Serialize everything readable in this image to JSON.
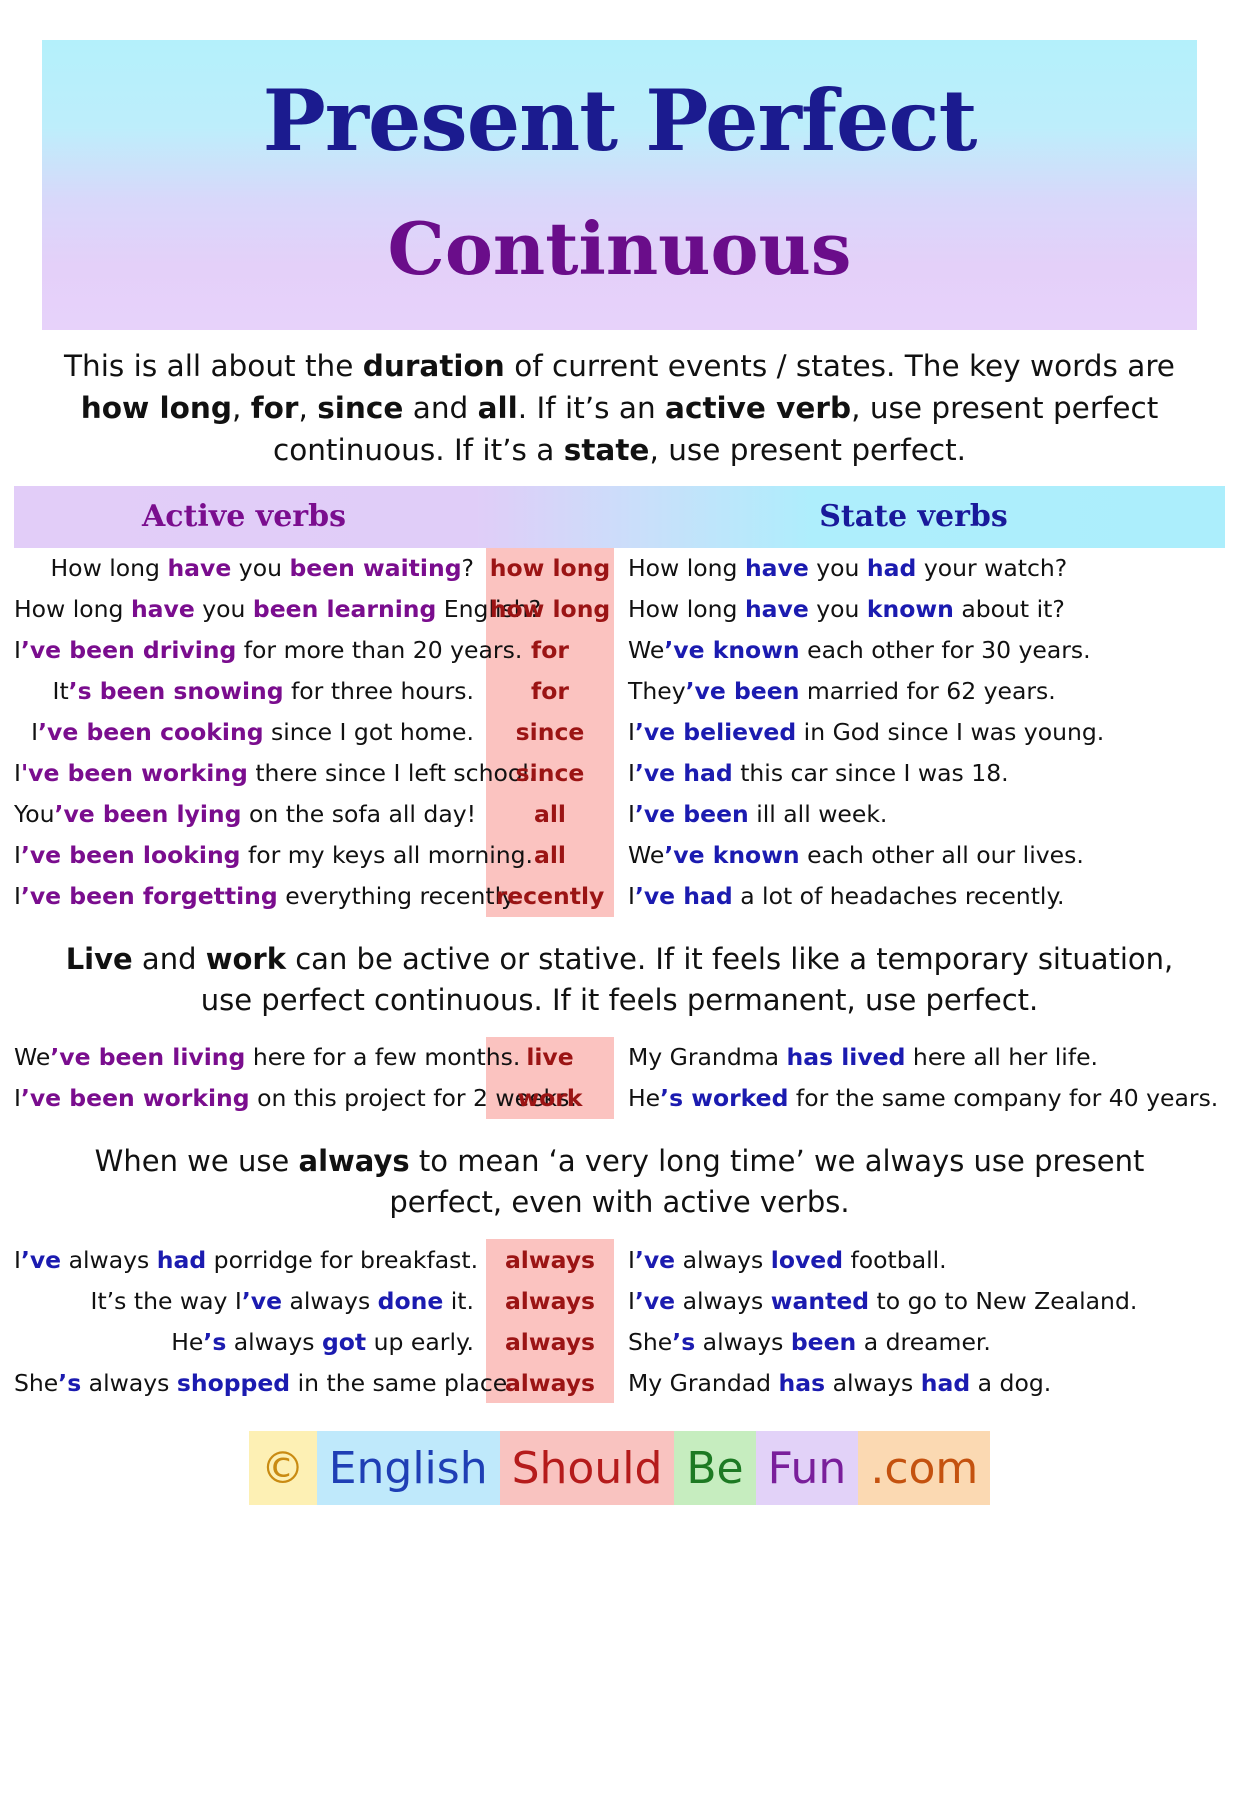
{
  "title": {
    "line1": "Present Perfect",
    "line2": "Continuous"
  },
  "intro": {
    "segments": [
      {
        "text": "This is all about the ",
        "style": "normal"
      },
      {
        "text": "duration",
        "style": "bold"
      },
      {
        "text": " of current events / states. The key words are ",
        "style": "normal"
      },
      {
        "text": "how long",
        "style": "bold"
      },
      {
        "text": ", ",
        "style": "normal"
      },
      {
        "text": "for",
        "style": "bold"
      },
      {
        "text": ", ",
        "style": "normal"
      },
      {
        "text": "since",
        "style": "bold"
      },
      {
        "text": " and ",
        "style": "normal"
      },
      {
        "text": "all",
        "style": "bold"
      },
      {
        "text": ". If it’s an ",
        "style": "normal"
      },
      {
        "text": "active verb",
        "style": "bold"
      },
      {
        "text": ", use present perfect continuous. If it’s a ",
        "style": "normal"
      },
      {
        "text": "state",
        "style": "bold"
      },
      {
        "text": ", use present perfect.",
        "style": "normal"
      }
    ]
  },
  "column_headers": {
    "left": "Active verbs",
    "right": "State verbs"
  },
  "table_main": {
    "rows": [
      {
        "keyword": "how long",
        "left": [
          {
            "t": "How long ",
            "s": "n"
          },
          {
            "t": "have",
            "s": "p"
          },
          {
            "t": " you ",
            "s": "n"
          },
          {
            "t": "been waiting",
            "s": "p"
          },
          {
            "t": "?",
            "s": "n"
          }
        ],
        "right": [
          {
            "t": "How long ",
            "s": "n"
          },
          {
            "t": "have",
            "s": "b"
          },
          {
            "t": " you ",
            "s": "n"
          },
          {
            "t": "had",
            "s": "b"
          },
          {
            "t": " your watch?",
            "s": "n"
          }
        ]
      },
      {
        "keyword": "how long",
        "left": [
          {
            "t": "How long ",
            "s": "n"
          },
          {
            "t": "have",
            "s": "p"
          },
          {
            "t": " you ",
            "s": "n"
          },
          {
            "t": "been learning",
            "s": "p"
          },
          {
            "t": " English?",
            "s": "n"
          }
        ],
        "right": [
          {
            "t": "How long ",
            "s": "n"
          },
          {
            "t": "have",
            "s": "b"
          },
          {
            "t": " you ",
            "s": "n"
          },
          {
            "t": "known",
            "s": "b"
          },
          {
            "t": " about it?",
            "s": "n"
          }
        ]
      },
      {
        "keyword": "for",
        "left": [
          {
            "t": "I",
            "s": "n"
          },
          {
            "t": "’ve been driving",
            "s": "p"
          },
          {
            "t": " for more than 20 years.",
            "s": "n"
          }
        ],
        "right": [
          {
            "t": "We",
            "s": "n"
          },
          {
            "t": "’ve known",
            "s": "b"
          },
          {
            "t": " each other for 30 years.",
            "s": "n"
          }
        ]
      },
      {
        "keyword": "for",
        "left": [
          {
            "t": "It",
            "s": "n"
          },
          {
            "t": "’s been snowing",
            "s": "p"
          },
          {
            "t": " for three hours.",
            "s": "n"
          }
        ],
        "right": [
          {
            "t": "They",
            "s": "n"
          },
          {
            "t": "’ve been",
            "s": "b"
          },
          {
            "t": " married for 62 years.",
            "s": "n"
          }
        ]
      },
      {
        "keyword": "since",
        "left": [
          {
            "t": "I",
            "s": "n"
          },
          {
            "t": "’ve been cooking",
            "s": "p"
          },
          {
            "t": " since I got home.",
            "s": "n"
          }
        ],
        "right": [
          {
            "t": "I",
            "s": "n"
          },
          {
            "t": "’ve believed",
            "s": "b"
          },
          {
            "t": " in God since I was young.",
            "s": "n"
          }
        ]
      },
      {
        "keyword": "since",
        "left": [
          {
            "t": "I",
            "s": "n"
          },
          {
            "t": "'ve been working",
            "s": "p"
          },
          {
            "t": " there since I left school.",
            "s": "n"
          }
        ],
        "right": [
          {
            "t": "I",
            "s": "n"
          },
          {
            "t": "’ve had",
            "s": "b"
          },
          {
            "t": " this car since I was 18.",
            "s": "n"
          }
        ]
      },
      {
        "keyword": "all",
        "left": [
          {
            "t": "You",
            "s": "n"
          },
          {
            "t": "’ve been lying",
            "s": "p"
          },
          {
            "t": " on the sofa all day!",
            "s": "n"
          }
        ],
        "right": [
          {
            "t": "I",
            "s": "n"
          },
          {
            "t": "’ve been",
            "s": "b"
          },
          {
            "t": " ill all week.",
            "s": "n"
          }
        ]
      },
      {
        "keyword": "all",
        "left": [
          {
            "t": "I",
            "s": "n"
          },
          {
            "t": "’ve been looking",
            "s": "p"
          },
          {
            "t": " for my keys all morning.",
            "s": "n"
          }
        ],
        "right": [
          {
            "t": "We",
            "s": "n"
          },
          {
            "t": "’ve known",
            "s": "b"
          },
          {
            "t": " each other all our lives.",
            "s": "n"
          }
        ]
      },
      {
        "keyword": "recently",
        "left": [
          {
            "t": "I",
            "s": "n"
          },
          {
            "t": "’ve been forgetting",
            "s": "p"
          },
          {
            "t": " everything recently.",
            "s": "n"
          }
        ],
        "right": [
          {
            "t": "I",
            "s": "n"
          },
          {
            "t": "’ve had",
            "s": "b"
          },
          {
            "t": " a lot of headaches recently.",
            "s": "n"
          }
        ]
      }
    ]
  },
  "para_livework": {
    "segments": [
      {
        "text": "Live",
        "style": "bold"
      },
      {
        "text": " and ",
        "style": "normal"
      },
      {
        "text": "work",
        "style": "bold"
      },
      {
        "text": " can be active or stative. If it feels like a temporary situation, use perfect continuous. If it feels permanent, use perfect.",
        "style": "normal"
      }
    ]
  },
  "table_livework": {
    "rows": [
      {
        "keyword": "live",
        "left": [
          {
            "t": "We",
            "s": "n"
          },
          {
            "t": "’ve been living",
            "s": "p"
          },
          {
            "t": " here for a few months.",
            "s": "n"
          }
        ],
        "right": [
          {
            "t": "My Grandma ",
            "s": "n"
          },
          {
            "t": "has lived",
            "s": "b"
          },
          {
            "t": " here all her life.",
            "s": "n"
          }
        ]
      },
      {
        "keyword": "work",
        "left": [
          {
            "t": "I",
            "s": "n"
          },
          {
            "t": "’ve been working",
            "s": "p"
          },
          {
            "t": " on this project for 2 weeks.",
            "s": "n"
          }
        ],
        "right": [
          {
            "t": "He",
            "s": "n"
          },
          {
            "t": "’s worked",
            "s": "b"
          },
          {
            "t": " for the same company for 40 years.",
            "s": "n"
          }
        ]
      }
    ]
  },
  "para_always": {
    "segments": [
      {
        "text": "When we use ",
        "style": "normal"
      },
      {
        "text": "always",
        "style": "bold"
      },
      {
        "text": " to mean ‘a very long time’ we always use present perfect, even with active verbs.",
        "style": "normal"
      }
    ]
  },
  "table_always": {
    "rows": [
      {
        "keyword": "always",
        "left": [
          {
            "t": "I",
            "s": "n"
          },
          {
            "t": "’ve",
            "s": "b"
          },
          {
            "t": " always ",
            "s": "n"
          },
          {
            "t": "had",
            "s": "b"
          },
          {
            "t": " porridge for breakfast.",
            "s": "n"
          }
        ],
        "right": [
          {
            "t": "I",
            "s": "n"
          },
          {
            "t": "’ve",
            "s": "b"
          },
          {
            "t": " always ",
            "s": "n"
          },
          {
            "t": "loved",
            "s": "b"
          },
          {
            "t": " football.",
            "s": "n"
          }
        ]
      },
      {
        "keyword": "always",
        "left": [
          {
            "t": "It’s the way I",
            "s": "n"
          },
          {
            "t": "’ve",
            "s": "b"
          },
          {
            "t": " always ",
            "s": "n"
          },
          {
            "t": "done",
            "s": "b"
          },
          {
            "t": " it.",
            "s": "n"
          }
        ],
        "right": [
          {
            "t": "I",
            "s": "n"
          },
          {
            "t": "’ve",
            "s": "b"
          },
          {
            "t": " always ",
            "s": "n"
          },
          {
            "t": "wanted",
            "s": "b"
          },
          {
            "t": " to go to New Zealand.",
            "s": "n"
          }
        ]
      },
      {
        "keyword": "always",
        "left": [
          {
            "t": "He",
            "s": "n"
          },
          {
            "t": "’s",
            "s": "b"
          },
          {
            "t": " always ",
            "s": "n"
          },
          {
            "t": "got",
            "s": "b"
          },
          {
            "t": " up early.",
            "s": "n"
          }
        ],
        "right": [
          {
            "t": "She",
            "s": "n"
          },
          {
            "t": "’s",
            "s": "b"
          },
          {
            "t": " always ",
            "s": "n"
          },
          {
            "t": "been",
            "s": "b"
          },
          {
            "t": " a dreamer.",
            "s": "n"
          }
        ]
      },
      {
        "keyword": "always",
        "left": [
          {
            "t": "She",
            "s": "n"
          },
          {
            "t": "’s",
            "s": "b"
          },
          {
            "t": " always ",
            "s": "n"
          },
          {
            "t": "shopped",
            "s": "b"
          },
          {
            "t": " in the same place.",
            "s": "n"
          }
        ],
        "right": [
          {
            "t": "My Grandad ",
            "s": "n"
          },
          {
            "t": "has",
            "s": "b"
          },
          {
            "t": " always ",
            "s": "n"
          },
          {
            "t": "had",
            "s": "b"
          },
          {
            "t": " a dog.",
            "s": "n"
          }
        ]
      }
    ]
  },
  "footer": {
    "copyright_icon": "©",
    "parts": [
      "English",
      "Should",
      "Be",
      "Fun",
      ".com"
    ]
  },
  "colors": {
    "title_primary": "#1b1b8f",
    "title_secondary": "#6a0d8a",
    "active_accent": "#7a0d8e",
    "state_accent": "#1b1bb0",
    "keyword_bg": "#fbc3c0",
    "keyword_text": "#9b1414"
  }
}
